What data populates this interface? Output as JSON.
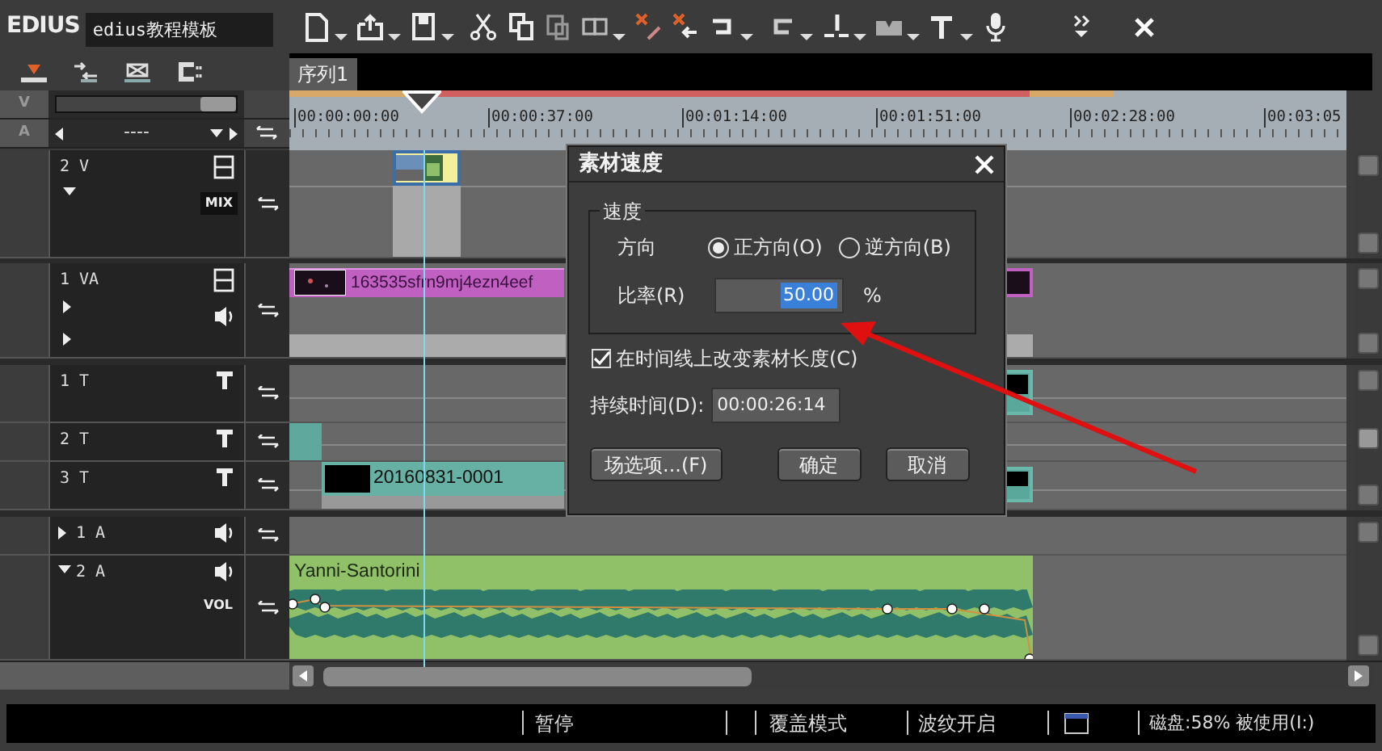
{
  "app": {
    "logo": "EDIUS",
    "project_name": "edius教程模板"
  },
  "sequence_tabs": [
    {
      "label": "序列1",
      "selected": true
    }
  ],
  "track_panel": {
    "zoom_slider": {
      "level": 1
    },
    "video_row": "V",
    "audio_row": "A",
    "audio_mode": "----"
  },
  "ruler": {
    "timecodes": [
      "00:00:00:00",
      "00:00:37:00",
      "00:01:14:00",
      "00:01:51:00",
      "00:02:28:00",
      "00:03:05"
    ]
  },
  "sections": [
    {
      "tracks": [
        {
          "label": "2 V",
          "kind": "video",
          "expanded": true,
          "tag": "MIX",
          "clips": [
            {
              "kind": "thumb"
            }
          ]
        }
      ]
    },
    {
      "tracks": [
        {
          "label": "1 VA",
          "kind": "videoaudio",
          "expanded": false,
          "clips": [
            {
              "kind": "video",
              "title": "163535sfrn9mj4ezn4eef"
            },
            {
              "kind": "video_tail"
            }
          ]
        }
      ]
    },
    {
      "tracks": [
        {
          "label": "1 T",
          "kind": "title",
          "clips": [
            {
              "kind": "title_tail"
            }
          ]
        },
        {
          "label": "2 T",
          "kind": "title",
          "clips": [
            {
              "kind": "title_block"
            }
          ]
        },
        {
          "label": "3 T",
          "kind": "title",
          "clips": [
            {
              "kind": "title",
              "title": "20160831-0001"
            },
            {
              "kind": "title_tail"
            }
          ]
        }
      ]
    },
    {
      "tracks": [
        {
          "label": "1 A",
          "kind": "audio",
          "expanded": false
        },
        {
          "label": "2 A",
          "kind": "audio",
          "expanded": true,
          "tag": "VOL",
          "clips": [
            {
              "kind": "audio",
              "title": "Yanni-Santorini"
            }
          ]
        }
      ]
    }
  ],
  "dialog": {
    "title": "素材速度",
    "group_title": "速度",
    "direction_label": "方向",
    "directions": [
      {
        "label": "正方向(O)",
        "selected": true
      },
      {
        "label": "逆方向(B)",
        "selected": false
      }
    ],
    "rate_label": "比率(R)",
    "rate_value": "50.00",
    "rate_unit": "%",
    "change_length": {
      "label": "在时间线上改变素材长度(C)",
      "checked": true
    },
    "duration_label": "持续时间(D):",
    "duration_value": "00:00:26:14",
    "buttons": [
      "场选项...(F)",
      "确定",
      "取消"
    ]
  },
  "status_bar": [
    "暂停",
    "覆盖模式",
    "波纹开启",
    "磁盘:58% 被使用(I:)"
  ]
}
